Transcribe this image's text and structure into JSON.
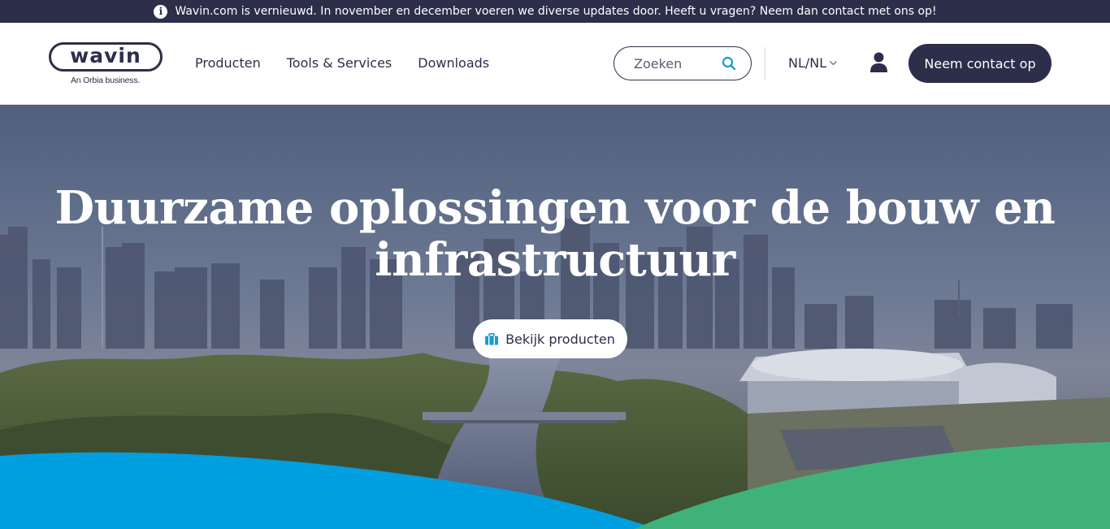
{
  "announcement": {
    "text": "Wavin.com is vernieuwd. In november en december voeren we diverse updates door. Heeft u vragen? Neem dan contact met ons op!",
    "icon": "info-icon"
  },
  "header": {
    "logo": {
      "word": "wavin",
      "tagline": "An Orbia business."
    },
    "nav": [
      {
        "label": "Producten"
      },
      {
        "label": "Tools & Services"
      },
      {
        "label": "Downloads"
      }
    ],
    "search": {
      "placeholder": "Zoeken",
      "icon": "search-icon"
    },
    "language": {
      "label": "NL/NL",
      "icon": "chevron-down-icon"
    },
    "account_icon": "user-icon",
    "contact_button": "Neem contact op"
  },
  "hero": {
    "title": "Duurzame oplossingen voor de bouw en infrastructuur",
    "button": {
      "label": "Bekijk producten",
      "icon": "briefcase-icon"
    }
  },
  "colors": {
    "navy": "#2c2e4a",
    "wave_blue": "#009fe0",
    "wave_green": "#3fb27a",
    "accent_icon": "#1a9ad6"
  }
}
